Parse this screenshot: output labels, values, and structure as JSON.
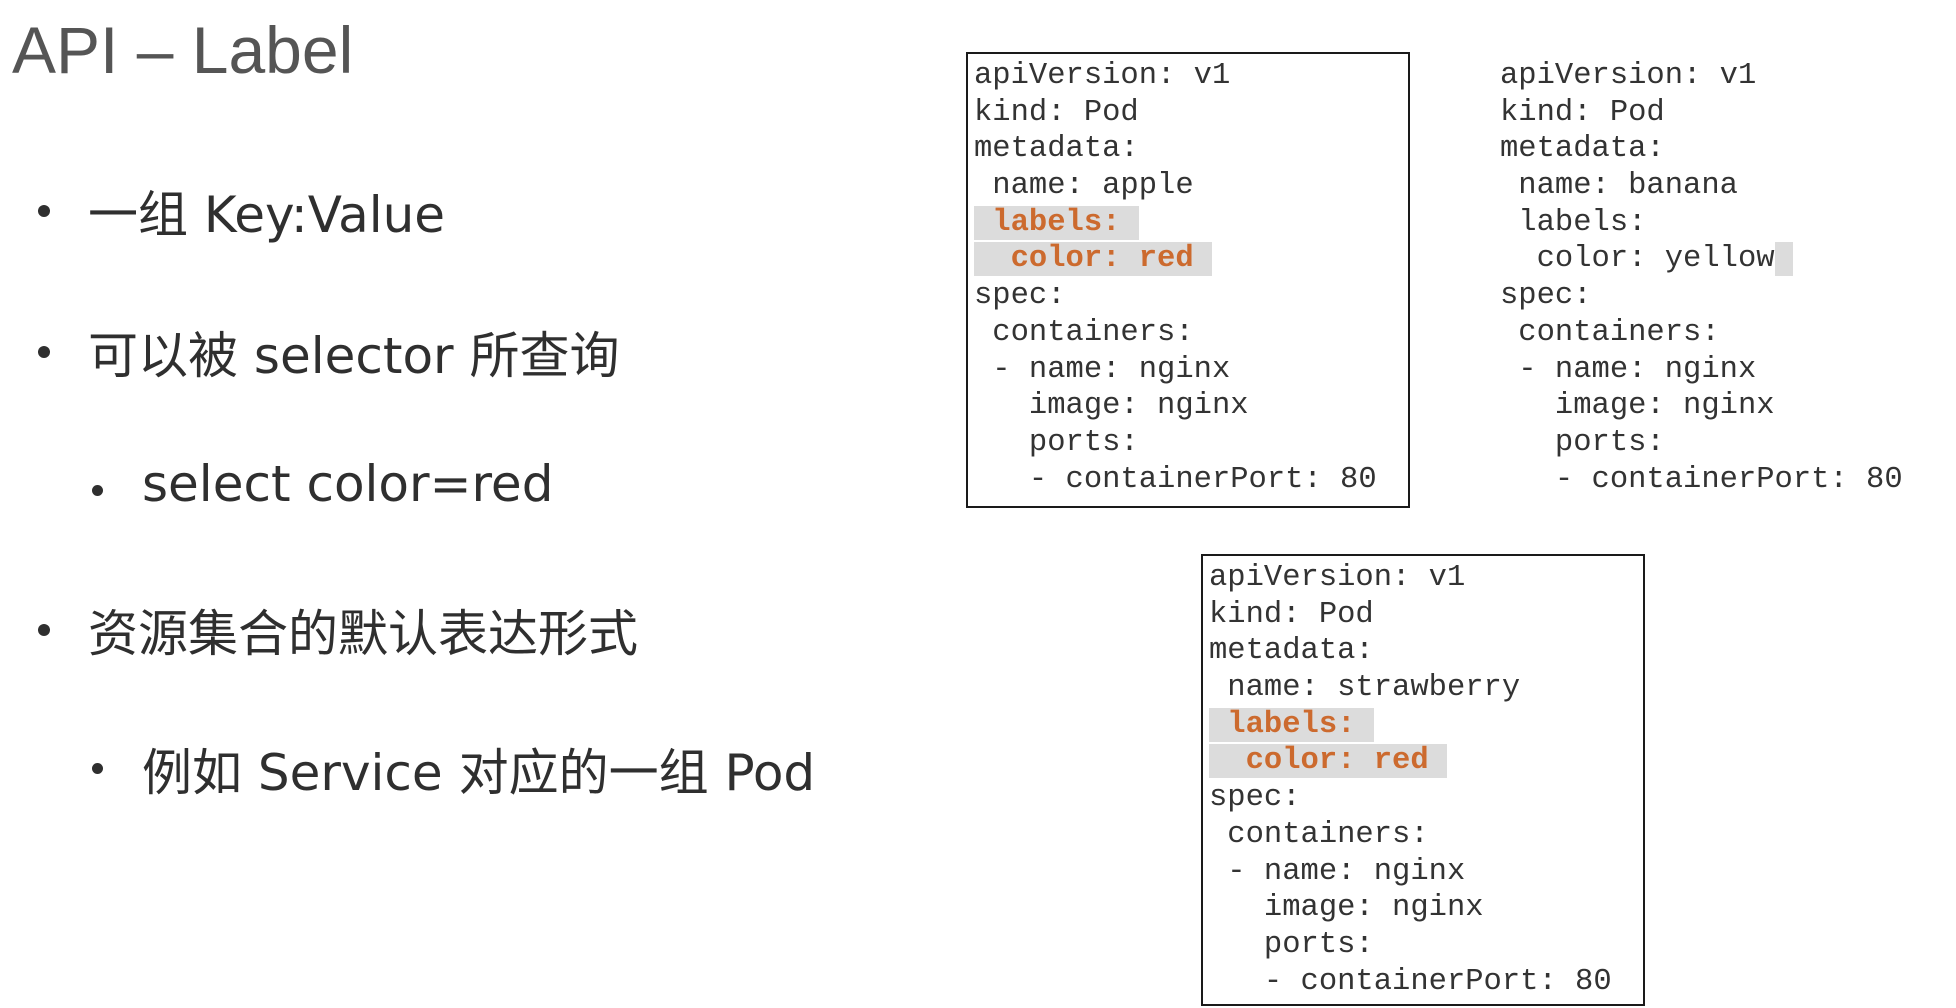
{
  "slide": {
    "title": "API – Label"
  },
  "bullets": [
    {
      "level": 1,
      "text": "一组 Key:Value"
    },
    {
      "level": 1,
      "text": "可以被 selector 所查询"
    },
    {
      "level": 2,
      "text": "select color=red"
    },
    {
      "level": 1,
      "text": "资源集合的默认表达形式"
    },
    {
      "level": 2,
      "text": "例如 Service 对应的一组 Pod"
    }
  ],
  "yaml_blocks": {
    "apple": {
      "lines": [
        "apiVersion: v1",
        "kind: Pod",
        "metadata:",
        " name: apple",
        " labels:",
        "  color: red",
        "spec:",
        " containers:",
        " - name: nginx",
        "   image: nginx",
        "   ports:",
        "   - containerPort: 80"
      ]
    },
    "banana": {
      "lines": [
        "apiVersion: v1",
        "kind: Pod",
        "metadata:",
        " name: banana",
        " labels:",
        "  color: yellow",
        "spec:",
        " containers:",
        " - name: nginx",
        "   image: nginx",
        "   ports:",
        "   - containerPort: 80"
      ]
    },
    "strawberry": {
      "lines": [
        "apiVersion: v1",
        "kind: Pod",
        "metadata:",
        " name: strawberry",
        " labels:",
        "  color: red",
        "spec:",
        " containers:",
        " - name: nginx",
        "   image: nginx",
        "   ports:",
        "   - containerPort: 80"
      ]
    }
  },
  "colors": {
    "highlight_text": "#cc6a2e",
    "highlight_bg": "#dcdcdc",
    "box_border": "#1a1a1a"
  }
}
